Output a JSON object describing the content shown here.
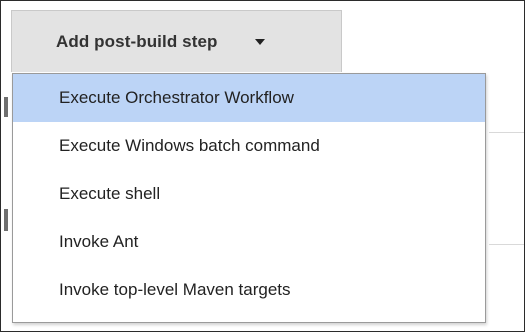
{
  "toolbar": {
    "add_post_build_step_label": "Add post-build step",
    "caret_icon": "caret-down-icon"
  },
  "dropdown": {
    "items": [
      {
        "label": "Execute Orchestrator Workflow",
        "highlighted": true
      },
      {
        "label": "Execute Windows batch command",
        "highlighted": false
      },
      {
        "label": "Execute shell",
        "highlighted": false
      },
      {
        "label": "Invoke Ant",
        "highlighted": false
      },
      {
        "label": "Invoke top-level Maven targets",
        "highlighted": false
      }
    ],
    "highlight_color": "#bcd4f6"
  },
  "colors": {
    "button_bg": "#e3e3e3",
    "border": "#2b2b2b"
  }
}
